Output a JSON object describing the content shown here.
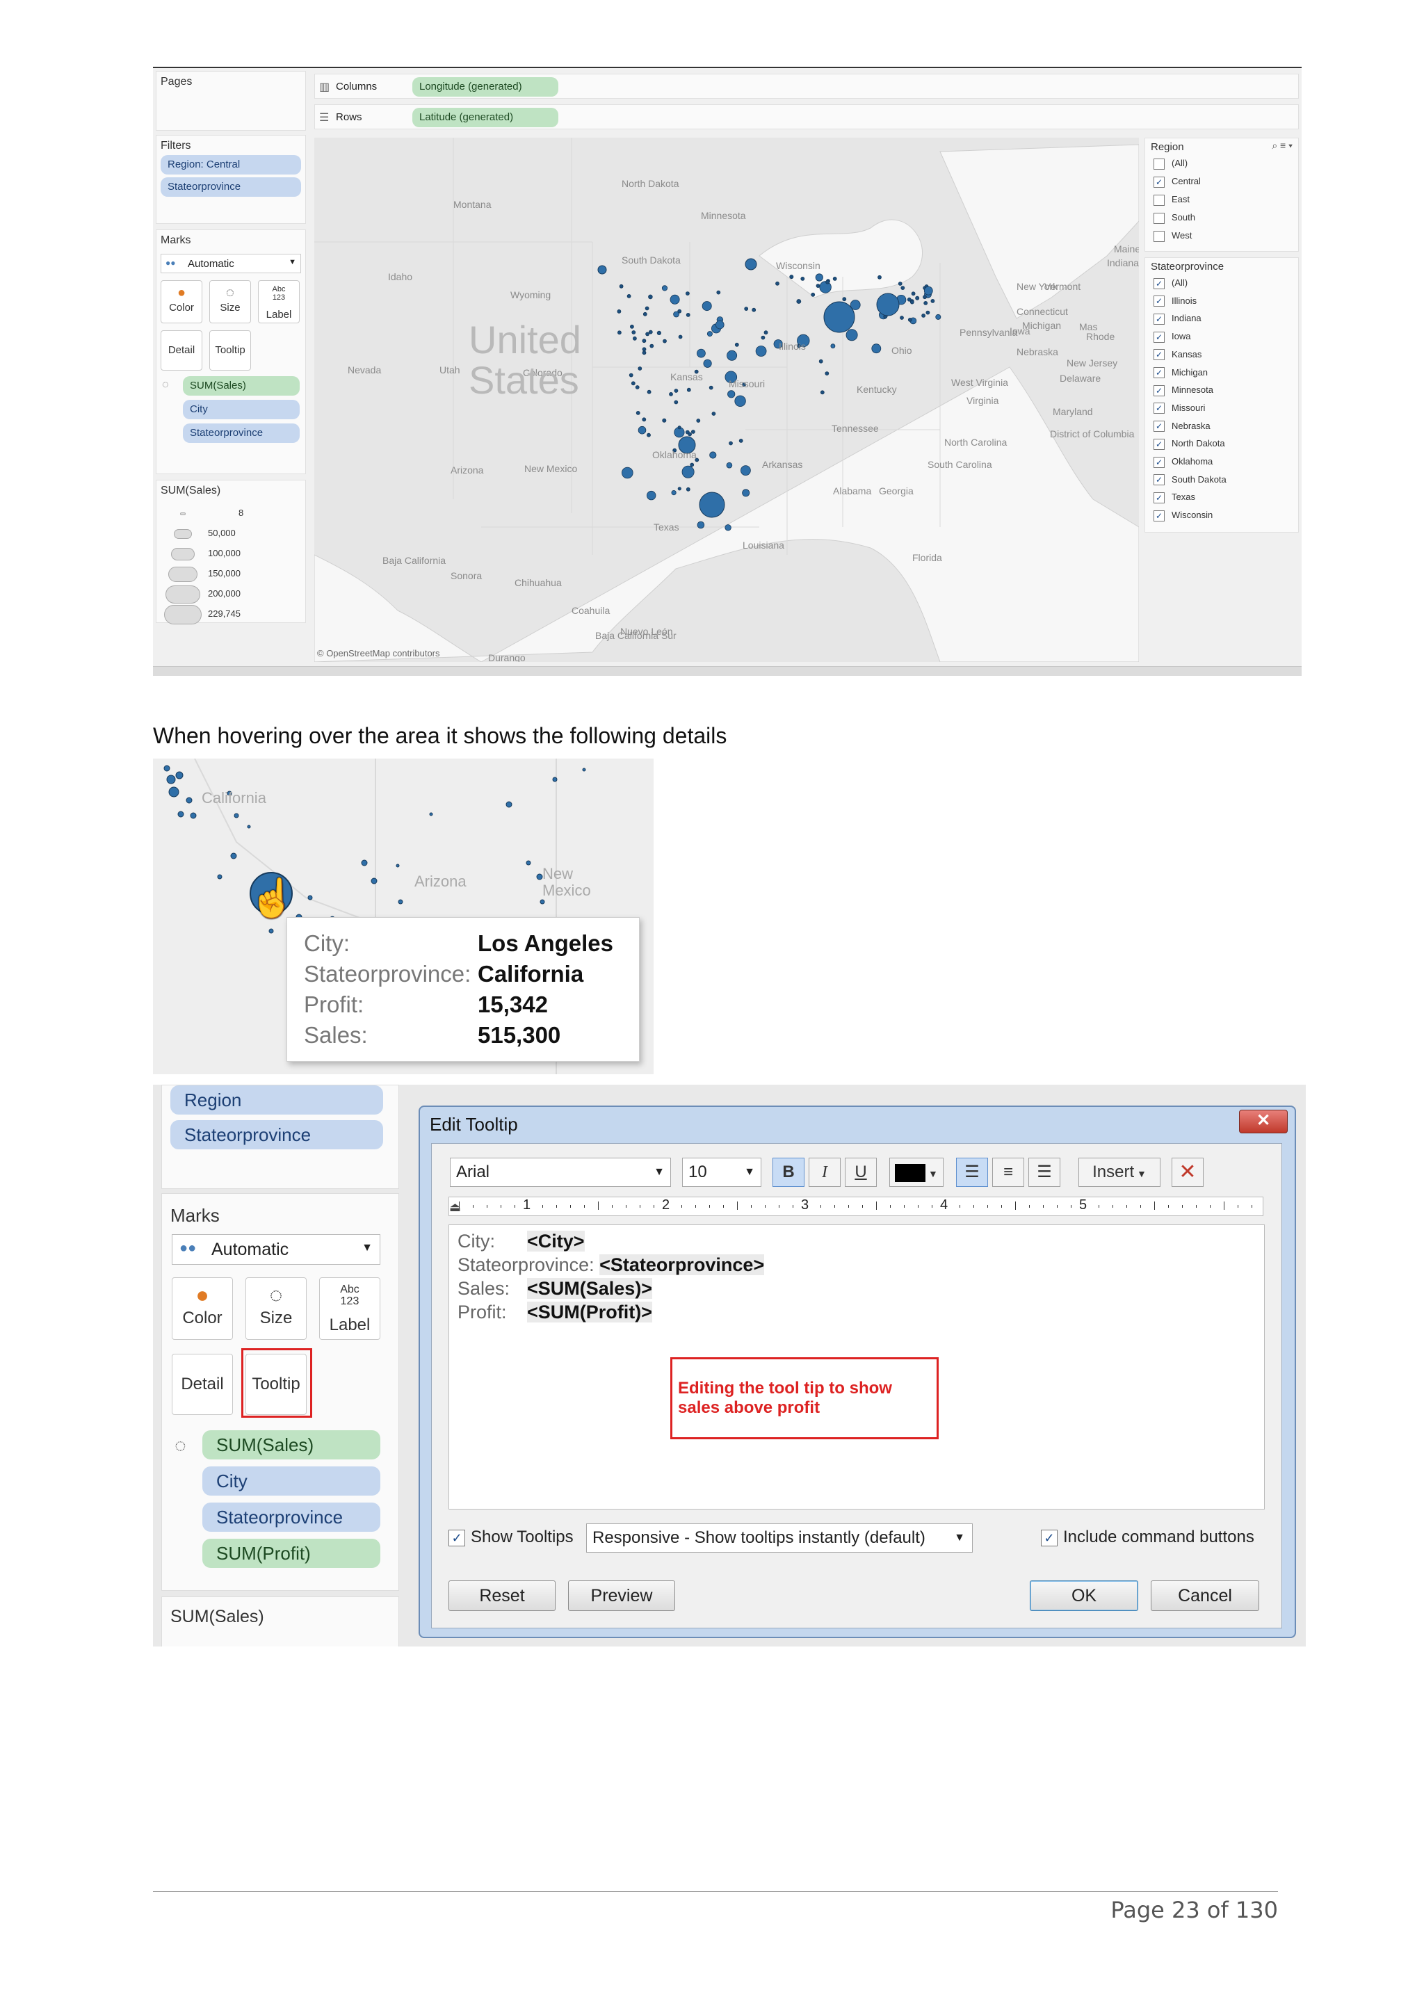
{
  "screenshot1": {
    "pages_label": "Pages",
    "columns_label": "Columns",
    "columns_pill": "Longitude (generated)",
    "rows_label": "Rows",
    "rows_pill": "Latitude (generated)",
    "filters_label": "Filters",
    "filter_pills": [
      "Region: Central",
      "Stateorprovince"
    ],
    "marks_label": "Marks",
    "marks_type": "Automatic",
    "mark_buttons": [
      "Color",
      "Size",
      "Label",
      "Detail",
      "Tooltip"
    ],
    "marks_pills": [
      "SUM(Sales)",
      "City",
      "Stateorprovince"
    ],
    "size_legend_title": "SUM(Sales)",
    "size_legend_values": [
      "8",
      "50,000",
      "100,000",
      "150,000",
      "200,000",
      "229,745"
    ],
    "map_attribution": "© OpenStreetMap contributors",
    "map_labels": {
      "country": [
        "United",
        "States"
      ],
      "places": [
        "Montana",
        "North Dakota",
        "Minnesota",
        "South Dakota",
        "Wisconsin",
        "Idaho",
        "Wyoming",
        "Nevada",
        "Utah",
        "Colorado",
        "Kansas",
        "Missouri",
        "Illinois",
        "Ohio",
        "Pennsylvania",
        "New York",
        "Vermont",
        "Maine",
        "Connecticut",
        "Rhode",
        "New Jersey",
        "Delaware",
        "Maryland",
        "District of Columbia",
        "West Virginia",
        "Virginia",
        "Kentucky",
        "Tennessee",
        "North Carolina",
        "South Carolina",
        "Arizona",
        "New Mexico",
        "Oklahoma",
        "Arkansas",
        "Texas",
        "Louisiana",
        "Alabama",
        "Georgia",
        "Florida",
        "Baja California",
        "Sonora",
        "Chihuahua",
        "Coahuila",
        "Nuevo León",
        "Durango",
        "Baja California Sur",
        "Michigan",
        "Indiana",
        "Iowa",
        "Nebraska",
        "Mas"
      ]
    },
    "region_filter": {
      "title": "Region",
      "items": [
        {
          "label": "(All)",
          "checked": false
        },
        {
          "label": "Central",
          "checked": true
        },
        {
          "label": "East",
          "checked": false
        },
        {
          "label": "South",
          "checked": false
        },
        {
          "label": "West",
          "checked": false
        }
      ]
    },
    "state_filter": {
      "title": "Stateorprovince",
      "items": [
        "(All)",
        "Illinois",
        "Indiana",
        "Iowa",
        "Kansas",
        "Michigan",
        "Minnesota",
        "Missouri",
        "Nebraska",
        "North Dakota",
        "Oklahoma",
        "South Dakota",
        "Texas",
        "Wisconsin"
      ]
    },
    "colors": {
      "dot": "#2f6fa8",
      "dot_dark": "#1d4f7e",
      "pill_blue": "#c6d7ef",
      "pill_green": "#bfe3c3"
    }
  },
  "caption": "When hovering over the area it shows the following details",
  "screenshot2": {
    "map_labels": [
      "California",
      "Arizona",
      "New Mexico"
    ],
    "tooltip": [
      {
        "key": "City:",
        "value": "Los Angeles"
      },
      {
        "key": "Stateorprovince:",
        "value": "California"
      },
      {
        "key": "Profit:",
        "value": "15,342"
      },
      {
        "key": "Sales:",
        "value": "515,300"
      }
    ]
  },
  "screenshot3": {
    "filter_pills": [
      "Region",
      "Stateorprovince"
    ],
    "marks_label": "Marks",
    "marks_type": "Automatic",
    "mark_buttons": [
      "Color",
      "Size",
      "Label",
      "Detail",
      "Tooltip"
    ],
    "marks_pills": [
      "SUM(Sales)",
      "City",
      "Stateorprovince",
      "SUM(Profit)"
    ],
    "size_legend_title": "SUM(Sales)",
    "dialog": {
      "title": "Edit Tooltip",
      "font": "Arial",
      "size": "10",
      "bold": "B",
      "italic": "I",
      "underline": "U",
      "insert": "Insert",
      "ruler_numbers": [
        "1",
        "2",
        "3",
        "4",
        "5"
      ],
      "editor_rows": [
        {
          "key": "City:",
          "value": "<City>"
        },
        {
          "key": "Stateorprovince:",
          "value": "<Stateorprovince>"
        },
        {
          "key": "Sales:",
          "value": "<SUM(Sales)>"
        },
        {
          "key": "Profit:",
          "value": "<SUM(Profit)>"
        }
      ],
      "annotation": "Editing the tool tip to show sales above profit",
      "show_tooltips_label": "Show Tooltips",
      "tooltip_mode": "Responsive - Show tooltips instantly (default)",
      "include_buttons_label": "Include command buttons",
      "buttons": {
        "reset": "Reset",
        "preview": "Preview",
        "ok": "OK",
        "cancel": "Cancel"
      }
    }
  },
  "footer": {
    "page_label": "Page 23 of 130"
  }
}
